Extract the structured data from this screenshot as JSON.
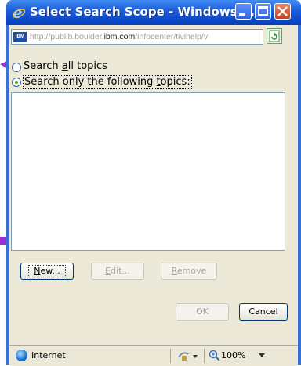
{
  "window": {
    "title": "Select Search Scope - Windows ...",
    "address_url_prefix": "http://publib.boulder.",
    "address_url_host": "ibm.com",
    "address_url_suffix": "/infocenter/tivihelp/v",
    "address_favicon_text": "IBM"
  },
  "options": {
    "all_topics": {
      "pre": "Search ",
      "key": "a",
      "post": "ll topics",
      "selected": false
    },
    "following_topics": {
      "pre": "Search only the following ",
      "key": "t",
      "post": "opics:",
      "selected": true
    }
  },
  "topics_list": {
    "items": []
  },
  "buttons": {
    "new": {
      "key": "N",
      "post": "ew...",
      "enabled": true
    },
    "edit": {
      "key": "E",
      "post": "dit...",
      "enabled": false
    },
    "remove": {
      "key": "R",
      "post": "emove",
      "enabled": false
    },
    "ok": {
      "label": "OK",
      "enabled": false
    },
    "cancel": {
      "label": "Cancel",
      "enabled": true
    }
  },
  "statusbar": {
    "zone": "Internet",
    "zoom": "100%"
  },
  "colors": {
    "annotation_arrow": "#9b2fd0",
    "titlebar": "#0a48c9"
  }
}
